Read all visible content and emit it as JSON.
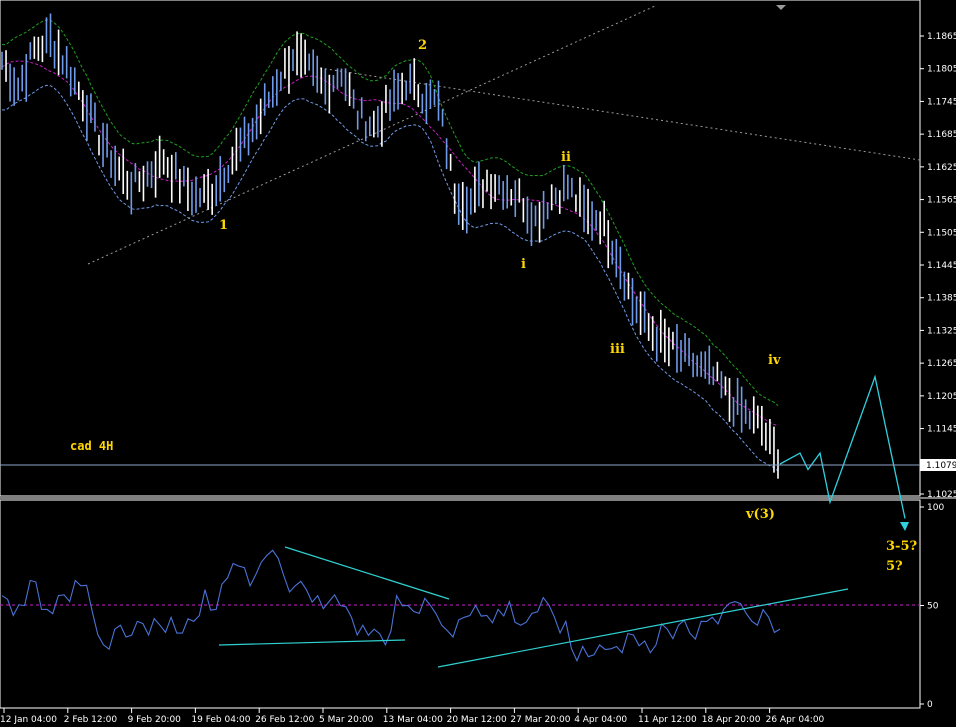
{
  "chart_data": [
    {
      "type": "candlestick",
      "title": "cad 4H",
      "y_axis_side": "right",
      "ylim": [
        1.098,
        1.191
      ],
      "y_ticks": [
        "1.1865",
        "1.1805",
        "1.1745",
        "1.1685",
        "1.1625",
        "1.1565",
        "1.1505",
        "1.1445",
        "1.1385",
        "1.1325",
        "1.1265",
        "1.1205",
        "1.1145",
        "1.1025"
      ],
      "current_price": "1.1079",
      "x_ticks": [
        "12 Jan 04:00",
        "2 Feb 12:00",
        "9 Feb 20:00",
        "19 Feb 04:00",
        "26 Feb 12:00",
        "5 Mar 20:00",
        "13 Mar 04:00",
        "20 Mar 12:00",
        "27 Mar 20:00",
        "4 Apr 04:00",
        "11 Apr 12:00",
        "18 Apr 20:00",
        "26 Apr 04:00"
      ],
      "wave_labels": [
        "1",
        "2",
        "i",
        "ii",
        "iii",
        "iv",
        "v(3)",
        "3-5?",
        "5?"
      ],
      "series": [
        {
          "name": "",
          "color": "#6f9be8",
          "values": [
            1.182,
            1.177,
            1.184,
            1.186,
            1.181,
            1.175,
            1.168,
            1.163,
            1.159,
            1.161,
            1.164,
            1.16,
            1.157,
            1.158,
            1.163,
            1.167,
            1.172,
            1.178,
            1.183,
            1.18,
            1.177,
            1.18,
            1.172,
            1.17,
            1.174,
            1.178,
            1.176,
            1.174,
            1.158,
            1.156,
            1.16,
            1.159,
            1.157,
            1.153,
            1.157,
            1.159,
            1.154,
            1.153,
            1.147,
            1.138,
            1.133,
            1.13,
            1.128,
            1.126,
            1.124,
            1.12,
            1.117,
            1.115,
            1.108
          ]
        },
        {
          "name": "",
          "color": "#c71fc7",
          "style": "dashed"
        },
        {
          "name": "",
          "color": "#1fa01f",
          "style": "dashed"
        },
        {
          "name": "",
          "color": "#6f9be8",
          "style": "dashed"
        }
      ],
      "projection": [
        1.108,
        1.11,
        1.107,
        1.11,
        1.101,
        1.124,
        1.098
      ],
      "grid": false
    },
    {
      "type": "line",
      "ylim": [
        0,
        100
      ],
      "y_ticks": [
        "100",
        "50",
        "0"
      ],
      "level_line": 50,
      "series": [
        {
          "name": "",
          "color": "#4a72d6",
          "values": [
            55,
            45,
            50,
            62,
            48,
            55,
            52,
            60,
            47,
            30,
            38,
            34,
            42,
            35,
            40,
            44,
            36,
            42,
            58,
            48,
            64,
            70,
            60,
            72,
            78,
            65,
            60,
            58,
            55,
            52,
            50,
            44,
            40,
            38,
            30,
            55,
            50,
            46,
            50,
            40,
            34,
            44,
            50,
            45,
            48,
            52,
            40,
            46,
            54,
            44,
            42,
            22,
            24,
            30,
            28,
            26,
            35,
            32,
            30,
            38,
            40,
            36,
            42,
            44,
            48,
            52,
            46,
            40,
            44,
            38
          ]
        }
      ],
      "trendlines": 4,
      "grid": false
    }
  ]
}
